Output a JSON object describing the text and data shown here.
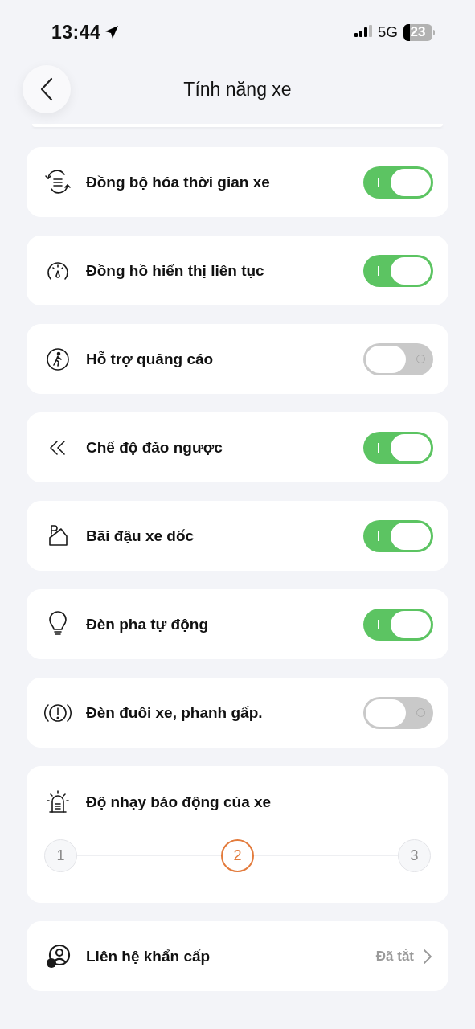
{
  "status_bar": {
    "time": "13:44",
    "network": "5G",
    "battery": "23"
  },
  "header": {
    "title": "Tính năng xe"
  },
  "settings": [
    {
      "label": "Đồng bộ hóa thời gian xe",
      "on": true
    },
    {
      "label": "Đồng hồ hiển thị liên tục",
      "on": true
    },
    {
      "label": "Hỗ trợ quảng cáo",
      "on": false
    },
    {
      "label": "Chế độ đảo ngược",
      "on": true
    },
    {
      "label": "Bãi đậu xe dốc",
      "on": true
    },
    {
      "label": "Đèn pha tự động",
      "on": true
    },
    {
      "label": "Đèn đuôi xe, phanh gấp.",
      "on": false
    }
  ],
  "alarm_sensitivity": {
    "label": "Độ nhạy báo động của xe",
    "steps": [
      {
        "label": "1",
        "selected": false
      },
      {
        "label": "2",
        "selected": true
      },
      {
        "label": "3",
        "selected": false
      }
    ]
  },
  "emergency_contact": {
    "label": "Liên hệ khẩn cấp",
    "value": "Đã tắt"
  }
}
